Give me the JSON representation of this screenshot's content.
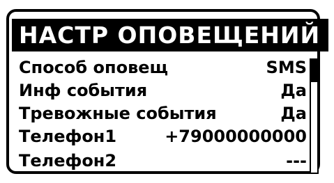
{
  "screen": {
    "title": "НАСТР ОПОВЕЩЕНИЙ",
    "items": [
      {
        "label": "Способ оповещ",
        "value": "SMS"
      },
      {
        "label": "Инф события",
        "value": "Да"
      },
      {
        "label": "Тревожные события",
        "value": "Да"
      },
      {
        "label": "Телефон1",
        "value": "+79000000000"
      },
      {
        "label": "Телефон2",
        "value": "---"
      }
    ],
    "scroll_position_fraction": 0.2
  }
}
